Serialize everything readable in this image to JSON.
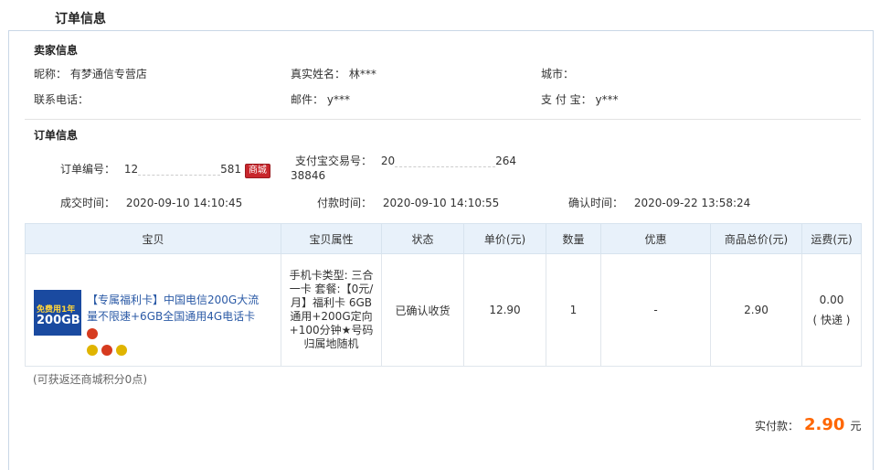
{
  "page_title": "订单信息",
  "seller": {
    "title": "卖家信息",
    "nickname_label": "昵称：",
    "nickname": "有梦通信专营店",
    "realname_label": "真实姓名：",
    "realname": "林***",
    "city_label": "城市：",
    "city": "",
    "phone_label": "联系电话：",
    "phone": "",
    "email_label": "邮件：",
    "email": "y***",
    "alipay_label": "支 付 宝：",
    "alipay": "y***"
  },
  "order": {
    "title": "订单信息",
    "order_no_label": "订单编号：",
    "order_no_prefix": "12",
    "order_no_suffix": "581",
    "mall_tag": "商城",
    "alipay_no_label": "支付宝交易号：",
    "alipay_no_prefix": "20",
    "alipay_no_suffix": "264",
    "alipay_no_line2": "38846",
    "deal_time_label": "成交时间：",
    "deal_time": "2020-09-10 14:10:45",
    "pay_time_label": "付款时间：",
    "pay_time": "2020-09-10 14:10:55",
    "confirm_time_label": "确认时间：",
    "confirm_time": "2020-09-22 13:58:24"
  },
  "table": {
    "headers": [
      "宝贝",
      "宝贝属性",
      "状态",
      "单价(元)",
      "数量",
      "优惠",
      "商品总价(元)",
      "运费(元)"
    ],
    "row": {
      "thumb_l1": "免费用1年",
      "thumb_l2": "200GB",
      "goods_name": "【专属福利卡】中国电信200G大流量不限速+6GB全国通用4G电话卡",
      "attrs": "手机卡类型: 三合一卡 套餐:【0元/月】福利卡 6GB通用+200G定向+100分钟★号码归属地随机",
      "status": "已确认收货",
      "unit_price": "12.90",
      "qty": "1",
      "discount": "-",
      "total": "2.90",
      "shipping": "0.00",
      "shipping_type": "( 快递 )"
    }
  },
  "points_note": "(可获返还商城积分0点)",
  "paid_label": "实付款：",
  "paid_amount": "2.90",
  "paid_unit": "元"
}
